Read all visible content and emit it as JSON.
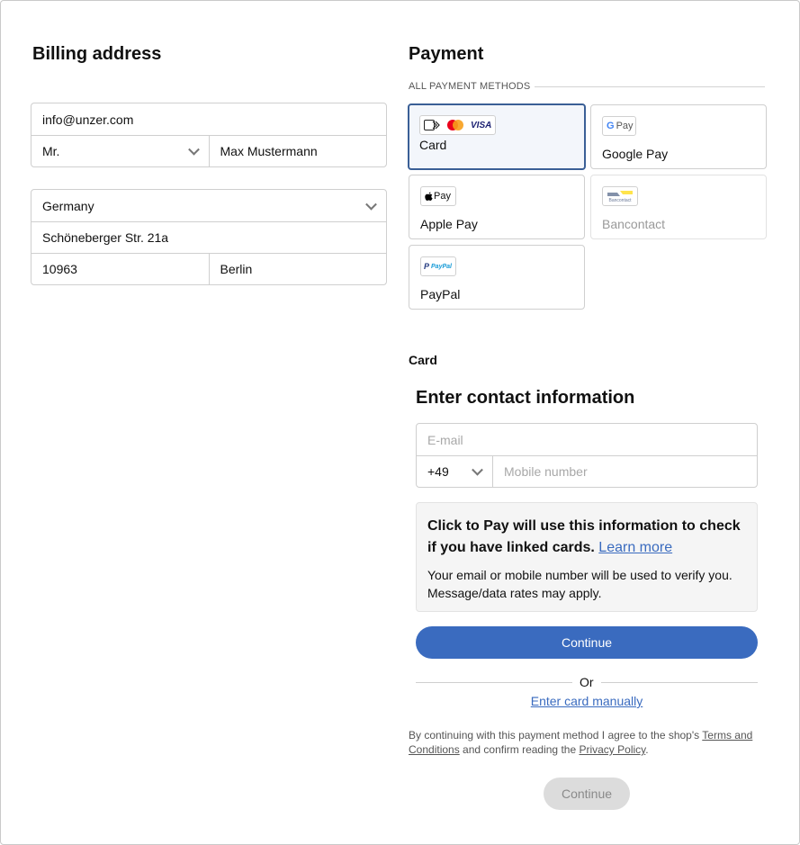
{
  "billing": {
    "title": "Billing address",
    "email": "info@unzer.com",
    "salutation": "Mr.",
    "name": "Max Mustermann",
    "country": "Germany",
    "street": "Schöneberger Str. 21a",
    "zip": "10963",
    "city": "Berlin"
  },
  "payment": {
    "title": "Payment",
    "methods_label": "ALL PAYMENT METHODS",
    "methods": [
      {
        "label": "Card",
        "selected": true
      },
      {
        "label": "Google Pay",
        "logo_text": "Pay"
      },
      {
        "label": "Apple Pay",
        "logo_text": "Pay"
      },
      {
        "label": "Bancontact",
        "logo_text": "Bancontact",
        "disabled": true
      },
      {
        "label": "PayPal",
        "logo_text": "PayPal"
      }
    ],
    "card_logos": {
      "visa": "VISA"
    }
  },
  "card_section": {
    "heading": "Card",
    "contact_title": "Enter contact information",
    "email_placeholder": "E-mail",
    "country_code": "+49",
    "mobile_placeholder": "Mobile number",
    "info_strong": "Click to Pay will use this information to check if you have linked cards.",
    "learn_more": "Learn more",
    "info_small": "Your email or mobile number will be used to verify you. Message/data rates may apply.",
    "continue_label": "Continue",
    "or_label": "Or",
    "manual_link": "Enter card manually"
  },
  "terms": {
    "prefix": "By continuing with this payment method I agree to the shop's",
    "terms_link": "Terms and Conditions",
    "middle": "and confirm reading the",
    "privacy_link": "Privacy Policy",
    "suffix": "."
  },
  "footer": {
    "continue_label": "Continue"
  },
  "colors": {
    "accent": "#3a6bbf",
    "selected_border": "#3a5f96",
    "disabled_button": "#dcdcdc"
  }
}
